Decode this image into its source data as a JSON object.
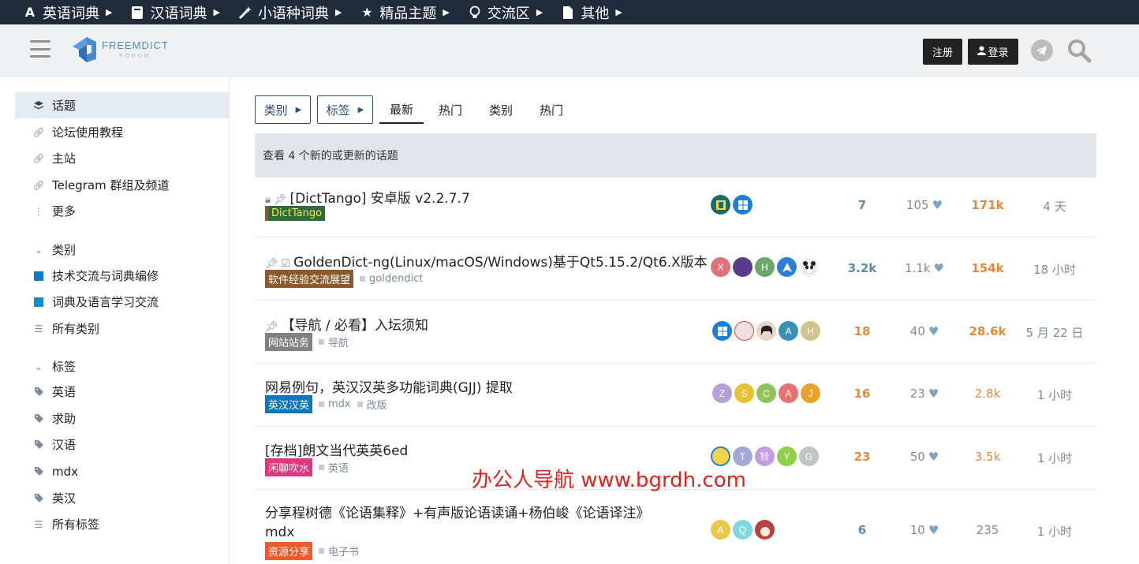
{
  "topnav": [
    {
      "label": "英语词典",
      "icon": "letter-a-icon"
    },
    {
      "label": "汉语词典",
      "icon": "book-icon"
    },
    {
      "label": "小语种词典",
      "icon": "magic-wand-icon"
    },
    {
      "label": "精品主题",
      "icon": "star-icon"
    },
    {
      "label": "交流区",
      "icon": "lightbulb-icon"
    },
    {
      "label": "其他",
      "icon": "file-icon"
    }
  ],
  "header": {
    "logo_title": "FREEMDICT",
    "logo_sub": "FORUM",
    "register": "注册",
    "login": "登录"
  },
  "sidebar": {
    "items": [
      {
        "label": "话题",
        "icon": "layers-icon"
      },
      {
        "label": "论坛使用教程",
        "icon": "link-icon"
      },
      {
        "label": "主站",
        "icon": "link-icon"
      },
      {
        "label": "Telegram 群组及频道",
        "icon": "link-icon"
      },
      {
        "label": "更多",
        "icon": "more-vertical-icon"
      }
    ],
    "categories_header": "类别",
    "categories": [
      {
        "label": "技术交流与词典编修",
        "color": "#0e7bc2"
      },
      {
        "label": "词典及语言学习交流",
        "color": "#0e8dc9"
      },
      {
        "label": "所有类别",
        "icon": "list-icon"
      }
    ],
    "tags_header": "标签",
    "tags": [
      {
        "label": "英语"
      },
      {
        "label": "求助"
      },
      {
        "label": "汉语"
      },
      {
        "label": "mdx"
      },
      {
        "label": "英汉"
      },
      {
        "label": "所有标签"
      }
    ]
  },
  "filters": {
    "category": "类别",
    "tag": "标签"
  },
  "tabs": [
    "最新",
    "热门",
    "类别",
    "热门"
  ],
  "new_topics_text": "查看 4 个新的或更新的话题",
  "topics": [
    {
      "title": "[DictTango] 安卓版 v2.2.7.7",
      "category": "DictTango",
      "category_bg": "#2f6b3d",
      "category_fg": "#f5e642",
      "tags": [],
      "avatars": [
        {
          "letter": "",
          "color": "#1a6e6a"
        },
        {
          "letter": "",
          "color": "#1d7fd6"
        }
      ],
      "replies": "7",
      "likes": "105",
      "views": "171k",
      "activity": "4 天"
    },
    {
      "title": "GoldenDict-ng(Linux/macOS/Windows)基于Qt5.15.2/Qt6.X版本",
      "category": "软件经验交流展望",
      "category_bg": "#8a5a2b",
      "category_fg": "#ffffff",
      "tags": [
        "goldendict"
      ],
      "avatars": [
        {
          "letter": "X",
          "color": "#e0717a"
        },
        {
          "letter": "",
          "color": "#5a3b8c"
        },
        {
          "letter": "H",
          "color": "#6aa96a"
        },
        {
          "letter": "",
          "color": "#2b7fd6"
        },
        {
          "letter": "",
          "color": "#f2f2f2"
        }
      ],
      "replies": "3.2k",
      "likes": "1.1k",
      "views": "154k",
      "activity": "18 小时"
    },
    {
      "title": "【导航 / 必看】入坛须知",
      "category": "网站站务",
      "category_bg": "#808281",
      "category_fg": "#ffffff",
      "tags": [
        "导航"
      ],
      "avatars": [
        {
          "letter": "",
          "color": "#1d7fd6"
        },
        {
          "letter": "",
          "color": "#f5e0e0"
        },
        {
          "letter": "",
          "color": "#e9d6c8"
        },
        {
          "letter": "A",
          "color": "#3a8fb7"
        },
        {
          "letter": "H",
          "color": "#cfc58a"
        }
      ],
      "replies": "18",
      "likes": "40",
      "views": "28.6k",
      "activity": "5 月 22 日"
    },
    {
      "title": "网易例句，英汉汉英多功能词典(GJJ) 提取",
      "category": "英汉汉英",
      "category_bg": "#0e76bd",
      "category_fg": "#ffffff",
      "tags": [
        "mdx",
        "改版"
      ],
      "avatars": [
        {
          "letter": "Z",
          "color": "#b59fd8"
        },
        {
          "letter": "S",
          "color": "#e8c030"
        },
        {
          "letter": "C",
          "color": "#8fc45a"
        },
        {
          "letter": "A",
          "color": "#e87070"
        },
        {
          "letter": "J",
          "color": "#e8a22a"
        }
      ],
      "replies": "16",
      "likes": "23",
      "views": "2.8k",
      "activity": "1 小时"
    },
    {
      "title": "[存档]朗文当代英英6ed",
      "category": "闲聊吹水",
      "category_bg": "#e4347f",
      "category_fg": "#ffffff",
      "tags": [
        "英语"
      ],
      "avatars": [
        {
          "letter": "",
          "color": "#f3d34a"
        },
        {
          "letter": "T",
          "color": "#a3a8d6"
        },
        {
          "letter": "铃",
          "color": "#c49be0"
        },
        {
          "letter": "Y",
          "color": "#8fd04a"
        },
        {
          "letter": "G",
          "color": "#c0c4c2"
        }
      ],
      "replies": "23",
      "likes": "50",
      "views": "3.5k",
      "activity": "1 小时"
    },
    {
      "title": "分享程树德《论语集释》+有声版论语读诵+杨伯峻《论语译注》",
      "title2": "mdx",
      "category": "资源分享",
      "category_bg": "#f0592b",
      "category_fg": "#ffffff",
      "tags": [
        "电子书"
      ],
      "avatars": [
        {
          "letter": "A",
          "color": "#e8c94a"
        },
        {
          "letter": "Q",
          "color": "#7fd8e0"
        },
        {
          "letter": "",
          "color": "#b7433b"
        }
      ],
      "replies": "6",
      "likes": "10",
      "views": "235",
      "activity": "1 小时"
    }
  ],
  "watermark": "办公人导航 www.bgrdh.com"
}
